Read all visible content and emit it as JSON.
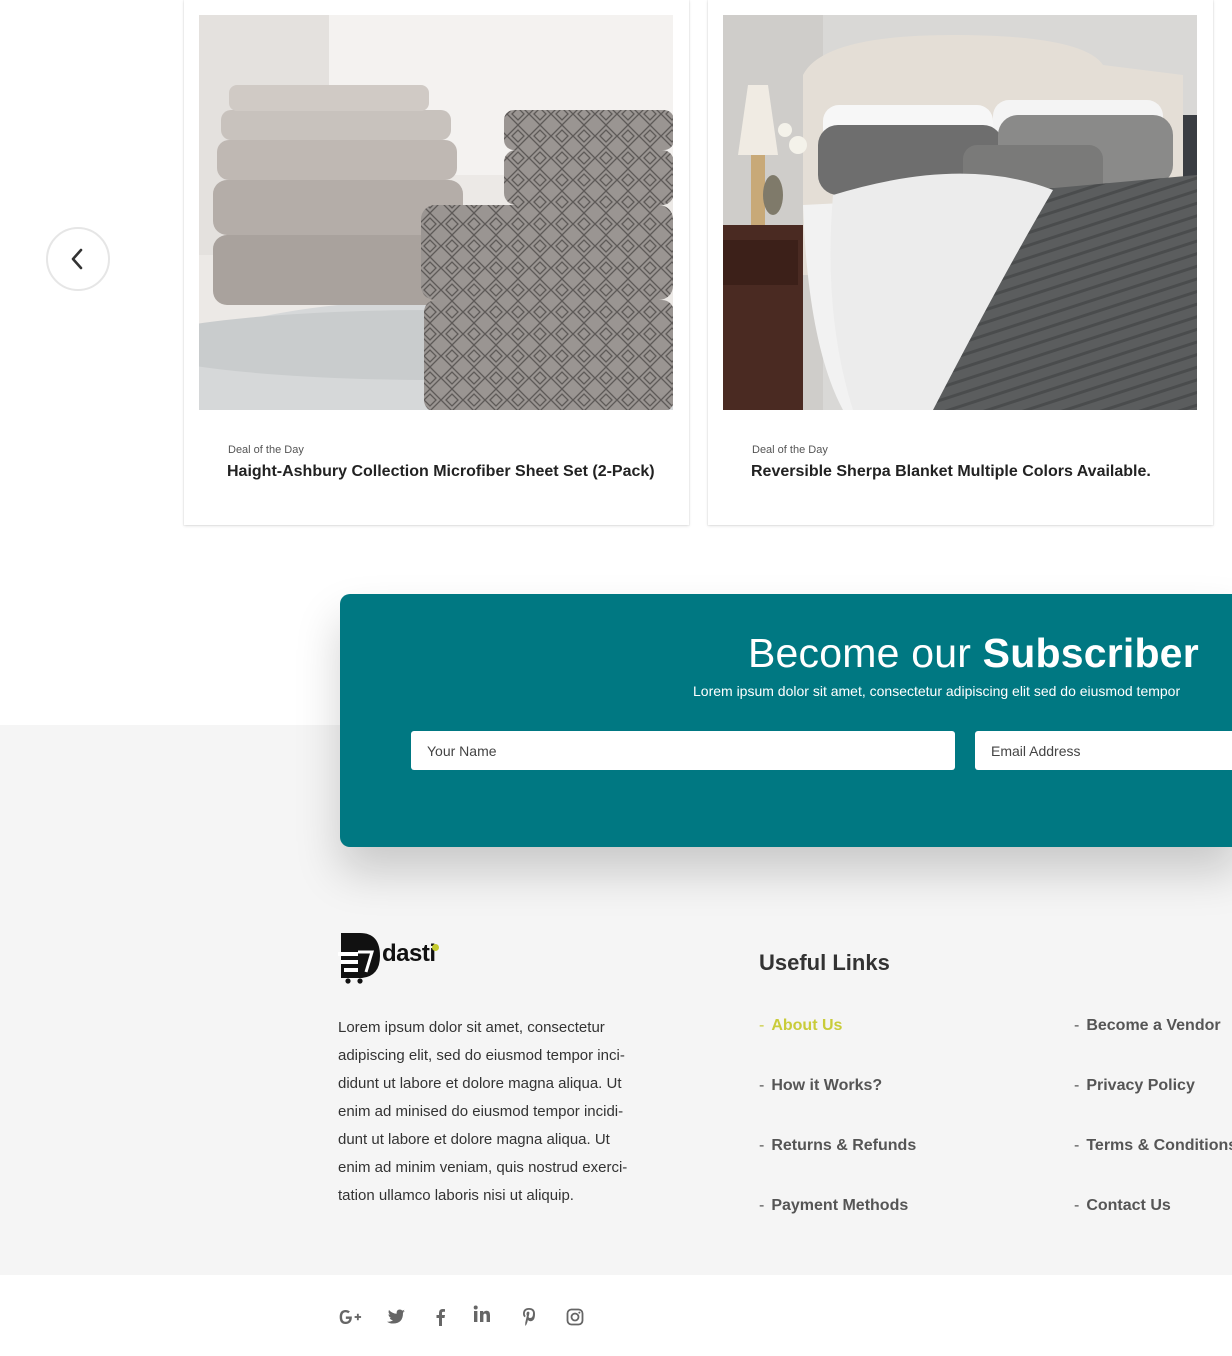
{
  "carousel": {
    "prev_icon": "chevron-left-icon",
    "cards": [
      {
        "kicker": "Deal of the Day",
        "title": "Haight-Ashbury Collection Microfiber Sheet Set (2-Pack)"
      },
      {
        "kicker": "Deal of the Day",
        "title": "Reversible Sherpa Blanket Multiple Colors Available."
      }
    ]
  },
  "subscribe": {
    "title_plain": "Become our ",
    "title_bold": "Subscriber",
    "text": "Lorem ipsum dolor sit amet, consectetur adipiscing elit sed do eiusmod tempor",
    "name_placeholder": "Your Name",
    "email_placeholder": "Email Address",
    "background": "#007882"
  },
  "footer": {
    "logo_text": "dasti",
    "about": "Lorem ipsum dolor sit amet, consectetur adipiscing elit, sed do eiusmod tempor inci-didunt ut labore et dolore magna aliqua. Ut enim ad minised do eiusmod tempor incidi-dunt ut labore et dolore magna aliqua. Ut enim ad minim veniam, quis nostrud exerci-tation ullamco laboris nisi ut aliquip.",
    "links_heading": "Useful Links",
    "dash": "-",
    "links": [
      {
        "label": "About Us",
        "active": true
      },
      {
        "label": "Become a Vendor"
      },
      {
        "label": "How it Works?"
      },
      {
        "label": "Privacy Policy"
      },
      {
        "label": "Returns & Refunds"
      },
      {
        "label": "Terms & Conditions"
      },
      {
        "label": "Payment Methods"
      },
      {
        "label": "Contact Us"
      }
    ],
    "accent_color": "#c9cc3a",
    "social": [
      "google-plus-icon",
      "twitter-icon",
      "facebook-icon",
      "linkedin-icon",
      "pinterest-icon",
      "instagram-icon"
    ]
  }
}
